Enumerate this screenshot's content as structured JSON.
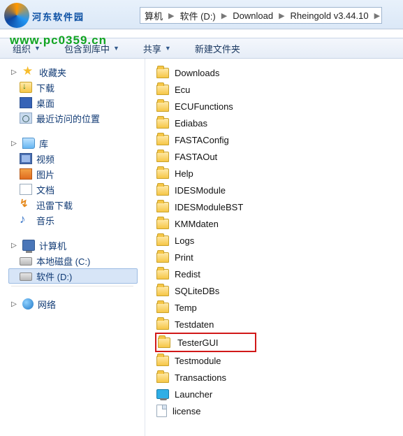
{
  "watermark": {
    "text": "河东软件园",
    "url": "www.pc0359.cn"
  },
  "breadcrumb": {
    "prefix_visible": "算机",
    "items": [
      "软件 (D:)",
      "Download",
      "Rheingold v3.44.10"
    ]
  },
  "toolbar": {
    "organize": "组织",
    "include": "包含到库中",
    "share": "共享",
    "newfolder": "新建文件夹"
  },
  "sidebar": {
    "favorites": {
      "label": "收藏夹",
      "items": [
        {
          "id": "downloads",
          "label": "下载",
          "icon": "ic-down"
        },
        {
          "id": "desktop",
          "label": "桌面",
          "icon": "ic-desk"
        },
        {
          "id": "recent",
          "label": "最近访问的位置",
          "icon": "ic-recent"
        }
      ]
    },
    "libraries": {
      "label": "库",
      "items": [
        {
          "id": "video",
          "label": "视频",
          "icon": "ic-video"
        },
        {
          "id": "pictures",
          "label": "图片",
          "icon": "ic-pic"
        },
        {
          "id": "documents",
          "label": "文档",
          "icon": "ic-doc"
        },
        {
          "id": "thunder",
          "label": "迅雷下载",
          "icon": "ic-thunder",
          "glyph": "↯"
        },
        {
          "id": "music",
          "label": "音乐",
          "icon": "ic-music",
          "glyph": "♪"
        }
      ]
    },
    "computer": {
      "label": "计算机",
      "items": [
        {
          "id": "drive-c",
          "label": "本地磁盘 (C:)",
          "icon": "ic-drive"
        },
        {
          "id": "drive-d",
          "label": "软件 (D:)",
          "icon": "ic-drive",
          "selected": true
        }
      ]
    },
    "network": {
      "label": "网络"
    }
  },
  "files": [
    {
      "name": "Downloads",
      "type": "folder"
    },
    {
      "name": "Ecu",
      "type": "folder"
    },
    {
      "name": "ECUFunctions",
      "type": "folder"
    },
    {
      "name": "Ediabas",
      "type": "folder"
    },
    {
      "name": "FASTAConfig",
      "type": "folder"
    },
    {
      "name": "FASTAOut",
      "type": "folder"
    },
    {
      "name": "Help",
      "type": "folder"
    },
    {
      "name": "IDESModule",
      "type": "folder"
    },
    {
      "name": "IDESModuleBST",
      "type": "folder"
    },
    {
      "name": "KMMdaten",
      "type": "folder"
    },
    {
      "name": "Logs",
      "type": "folder"
    },
    {
      "name": "Print",
      "type": "folder"
    },
    {
      "name": "Redist",
      "type": "folder"
    },
    {
      "name": "SQLiteDBs",
      "type": "folder"
    },
    {
      "name": "Temp",
      "type": "folder"
    },
    {
      "name": "Testdaten",
      "type": "folder"
    },
    {
      "name": "TesterGUI",
      "type": "folder",
      "highlight": true
    },
    {
      "name": "Testmodule",
      "type": "folder"
    },
    {
      "name": "Transactions",
      "type": "folder"
    },
    {
      "name": "Launcher",
      "type": "launcher"
    },
    {
      "name": "license",
      "type": "file"
    }
  ]
}
